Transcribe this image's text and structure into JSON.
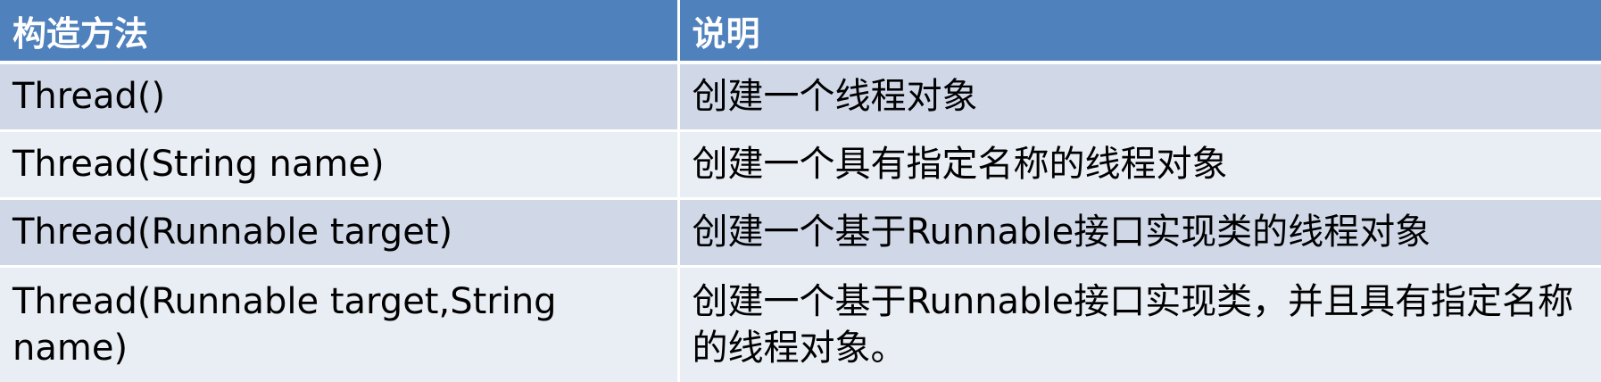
{
  "table": {
    "headers": [
      "构造方法",
      "说明"
    ],
    "rows": [
      [
        "Thread()",
        "创建一个线程对象"
      ],
      [
        "Thread(String name)",
        "创建一个具有指定名称的线程对象"
      ],
      [
        "Thread(Runnable target)",
        "创建一个基于Runnable接口实现类的线程对象"
      ],
      [
        "Thread(Runnable target,String name)",
        "创建一个基于Runnable接口实现类，并且具有指定名称的线程对象。"
      ]
    ]
  },
  "colors": {
    "header_bg": "#4f81bd",
    "row_odd_bg": "#d0d8e8",
    "row_even_bg": "#e9edf4",
    "header_text": "#ffffff",
    "body_text": "#000000"
  }
}
